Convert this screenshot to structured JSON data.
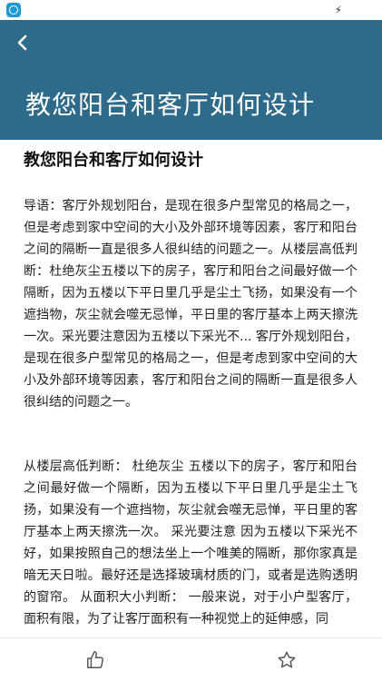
{
  "status_bar": {
    "app_icon": "app-circle-icon",
    "right_icon": "lightning-bolt-icon",
    "right_glyph": "⚡"
  },
  "header": {
    "title": "教您阳台和客厅如何设计",
    "back_icon": "chevron-left-icon",
    "background_color": "#2e6a8a"
  },
  "article": {
    "title": "教您阳台和客厅如何设计",
    "paragraphs": [
      "导语：客厅外规划阳台，是现在很多户型常见的格局之一，但是考虑到家中空间的大小及外部环境等因素，客厅和阳台之间的隔断一直是很多人很纠结的问题之一。从楼层高低判断：杜绝灰尘五楼以下的房子，客厅和阳台之间最好做一个隔断，因为五楼以下平日里几乎是尘土飞扬，如果没有一个遮挡物，灰尘就会噬无忌惮，平日里的客厅基本上两天擦洗一次。采光要注意因为五楼以下采光不... 客厅外规划阳台，是现在很多户型常见的格局之一，但是考虑到家中空间的大小及外部环境等因素，客厅和阳台之间的隔断一直是很多人很纠结的问题之一。",
      "从楼层高低判断： 杜绝灰尘 五楼以下的房子，客厅和阳台之间最好做一个隔断，因为五楼以下平日里几乎是尘土飞扬，如果没有一个遮挡物，灰尘就会噬无忌惮，平日里的客厅基本上两天擦洗一次。 采光要注意 因为五楼以下采光不好，如果按照自己的想法坐上一个唯美的隔断，那你家真是暗无天日啦。最好还是选择玻璃材质的门，或者是选购透明的窗帘。 从面积大小判断： 一般来说，对于小户型客厅，面积有限，为了让客厅面积有一种视觉上的延伸感，同"
    ]
  },
  "bottom_bar": {
    "like_icon": "thumbs-up-icon",
    "favorite_icon": "star-icon"
  }
}
